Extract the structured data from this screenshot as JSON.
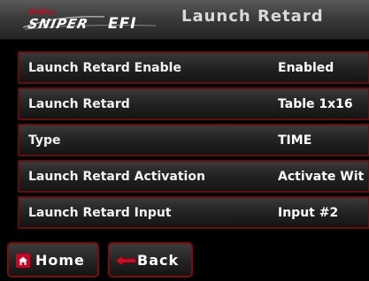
{
  "header": {
    "logo": {
      "brand_small": "Holley",
      "brand_main": "SNIPER",
      "brand_suffix": "EFI"
    },
    "title": "Launch Retard"
  },
  "settings": [
    {
      "label": "Launch Retard Enable",
      "value": "Enabled"
    },
    {
      "label": "Launch Retard",
      "value": "Table 1x16"
    },
    {
      "label": "Type",
      "value": "TIME"
    },
    {
      "label": "Launch Retard Activation",
      "value": "Activate Wit"
    },
    {
      "label": "Launch Retard Input",
      "value": "Input #2"
    }
  ],
  "nav": {
    "home_label": "Home",
    "back_label": "Back"
  },
  "icons": {
    "home": "home-icon",
    "back": "back-arrow-icon"
  },
  "colors": {
    "accent": "#d0001e",
    "border": "#6a0b0b",
    "background": "#000000",
    "text": "#ffffff"
  }
}
